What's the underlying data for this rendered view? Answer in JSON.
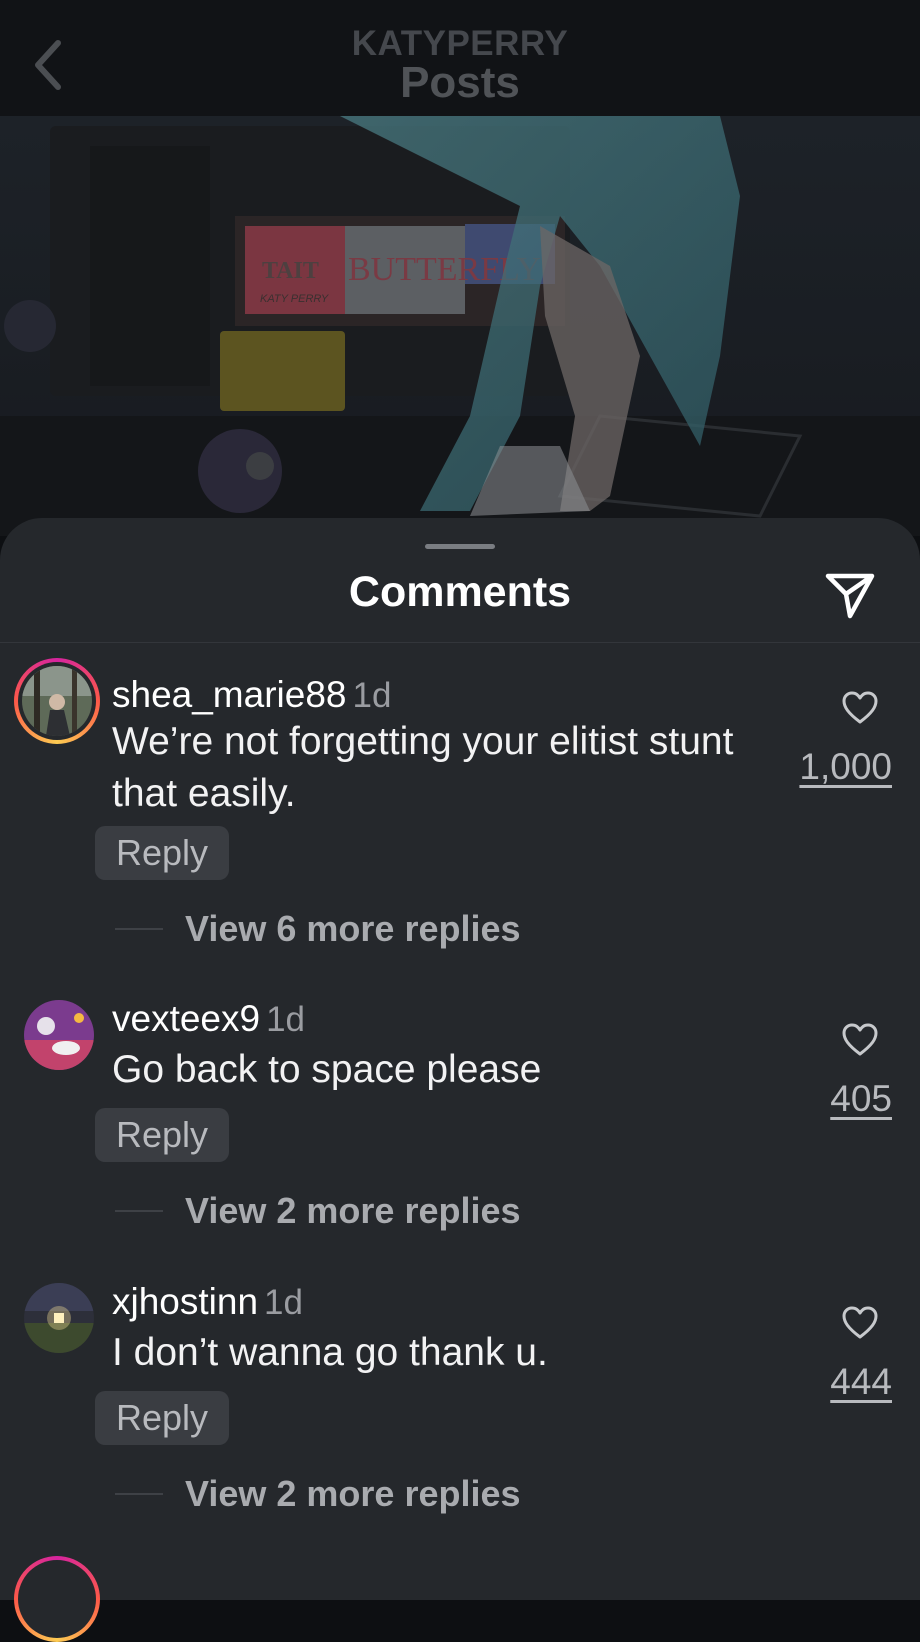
{
  "header": {
    "account": "KATYPERRY",
    "section": "Posts"
  },
  "photo": {
    "sign_brand": "TAIT",
    "sign_sub": "KATY PERRY",
    "sign_text": "BUTTERFLY"
  },
  "sheet": {
    "title": "Comments"
  },
  "comments": [
    {
      "username": "shea_marie88",
      "time": "1d",
      "text": "We’re not forgetting your elitist stunt that easily.",
      "reply": "Reply",
      "view_more": "View 6 more replies",
      "likes": "1,000"
    },
    {
      "username": "vexteex9",
      "time": "1d",
      "text": "Go back to space please",
      "reply": "Reply",
      "view_more": "View 2 more replies",
      "likes": "405"
    },
    {
      "username": "xjhostinn",
      "time": "1d",
      "text": "I don’t wanna go thank u.",
      "reply": "Reply",
      "view_more": "View 2 more replies",
      "likes": "444"
    }
  ]
}
